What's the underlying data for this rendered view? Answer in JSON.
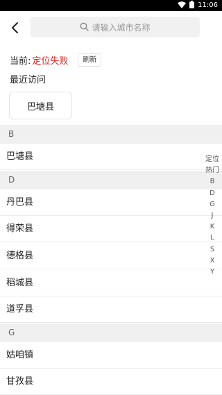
{
  "status_bar": {
    "time": "11:06"
  },
  "search": {
    "placeholder": "请输入城市名称"
  },
  "location": {
    "label": "当前:",
    "status": "定位失败",
    "refresh_label": "刷新"
  },
  "recent": {
    "title": "最近访问",
    "items": [
      "巴塘县"
    ]
  },
  "sections": [
    {
      "letter": "B",
      "cities": [
        "巴塘县"
      ]
    },
    {
      "letter": "D",
      "cities": [
        "丹巴县",
        "得荣县",
        "德格县",
        "稻城县",
        "道孚县"
      ]
    },
    {
      "letter": "G",
      "cities": [
        "姑咱镇",
        "甘孜县"
      ]
    }
  ],
  "index_bar": [
    "定位",
    "热门",
    "B",
    "D",
    "G",
    "J",
    "K",
    "L",
    "S",
    "X",
    "Y"
  ],
  "colors": {
    "status_fail": "#e02020",
    "section_bg": "#f0f0f0",
    "search_bg": "#f1f1f1"
  }
}
